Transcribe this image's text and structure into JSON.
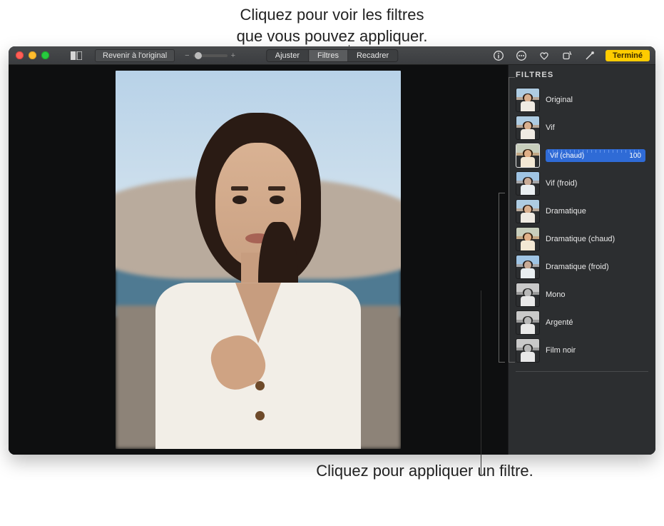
{
  "callouts": {
    "top": "Cliquez pour voir les filtres\nque vous pouvez appliquer.",
    "bottom": "Cliquez pour appliquer un filtre."
  },
  "toolbar": {
    "revert_label": "Revenir à l'original",
    "zoom_minus": "−",
    "zoom_plus": "+",
    "tabs": {
      "adjust": "Ajuster",
      "filters": "Filtres",
      "crop": "Recadrer",
      "active": "filters"
    },
    "right": {
      "done_label": "Terminé"
    }
  },
  "sidebar": {
    "header": "FILTRES",
    "selected_index": 2,
    "selected_intensity": 100,
    "filters": [
      {
        "id": "original",
        "label": "Original",
        "variant": "color"
      },
      {
        "id": "vif",
        "label": "Vif",
        "variant": "color"
      },
      {
        "id": "vif-chaud",
        "label": "Vif (chaud)",
        "variant": "warm"
      },
      {
        "id": "vif-froid",
        "label": "Vif (froid)",
        "variant": "cool"
      },
      {
        "id": "dramatique",
        "label": "Dramatique",
        "variant": "color"
      },
      {
        "id": "dramatique-chaud",
        "label": "Dramatique (chaud)",
        "variant": "warm"
      },
      {
        "id": "dramatique-froid",
        "label": "Dramatique (froid)",
        "variant": "cool"
      },
      {
        "id": "mono",
        "label": "Mono",
        "variant": "mono"
      },
      {
        "id": "argente",
        "label": "Argenté",
        "variant": "mono"
      },
      {
        "id": "film-noir",
        "label": "Film noir",
        "variant": "mono"
      }
    ]
  }
}
